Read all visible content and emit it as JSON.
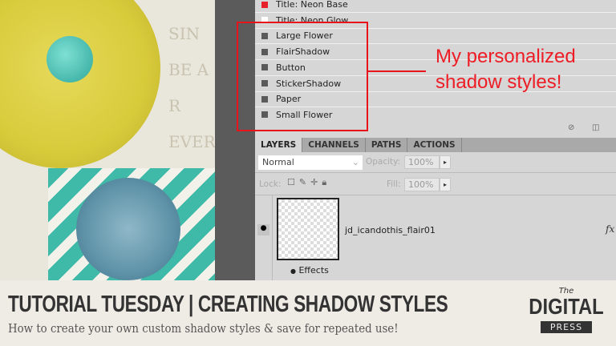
{
  "styles_list": [
    "Title: Neon Base",
    "Title: Neon Glow",
    "Large Flower",
    "FlairShadow",
    "Button",
    "StickerShadow",
    "Paper",
    "Small Flower"
  ],
  "styles_colors": [
    "#e8202a",
    "#ffffff",
    "#5a5a5a",
    "#5a5a5a",
    "#5a5a5a",
    "#5a5a5a",
    "#5a5a5a",
    "#5a5a5a"
  ],
  "annotation": {
    "line1": "My personalized",
    "line2": "shadow styles!",
    "color": "#ee1c25"
  },
  "tabs": [
    "LAYERS",
    "CHANNELS",
    "PATHS",
    "ACTIONS"
  ],
  "layers": {
    "blend_mode": "Normal",
    "opacity_label": "Opacity:",
    "opacity": "100%",
    "lock_label": "Lock:",
    "fill_label": "Fill:",
    "fill": "100%",
    "layer_name": "jd_icandothis_flair01",
    "fx": "fx",
    "effects": "Effects"
  },
  "art_text": [
    "SIN",
    "BE A",
    "R EVER"
  ],
  "footer": {
    "title": "TUTORIAL TUESDAY | CREATING SHADOW STYLES",
    "subtitle": "How to create your own custom shadow styles & save for repeated use!",
    "logo_the": "The",
    "logo_digital": "DIGITAL",
    "logo_press": "PRESS"
  }
}
